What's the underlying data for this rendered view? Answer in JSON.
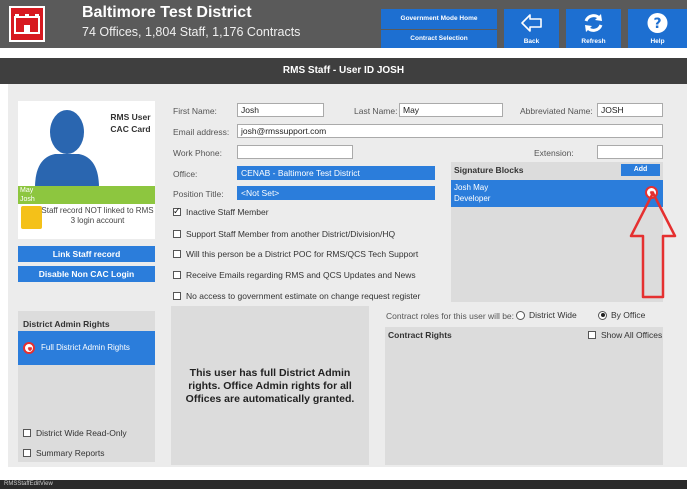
{
  "header": {
    "title": "Baltimore Test District",
    "subtitle": "74 Offices, 1,804 Staff, 1,176 Contracts",
    "gov_mode": "Government Mode Home",
    "contract_selection": "Contract Selection",
    "back": "Back",
    "refresh": "Refresh",
    "help": "Help"
  },
  "page_title": "RMS Staff - User ID JOSH",
  "avatar_card": {
    "title": "RMS User CAC Card",
    "name_line1": "May",
    "name_line2": "Josh",
    "status": "Staff record NOT linked to RMS 3 login account"
  },
  "buttons": {
    "link_staff": "Link Staff record",
    "disable_cac": "Disable Non CAC Login"
  },
  "form": {
    "first_name_label": "First Name:",
    "first_name": "Josh",
    "last_name_label": "Last Name:",
    "last_name": "May",
    "abbr_label": "Abbreviated Name:",
    "abbr": "JOSH",
    "email_label": "Email address:",
    "email": "josh@rmssupport.com",
    "work_phone_label": "Work Phone:",
    "work_phone": "",
    "extension_label": "Extension:",
    "extension": "",
    "office_label": "Office:",
    "office": "CENAB - Baltimore Test District",
    "position_label": "Position Title:",
    "position": "<Not Set>"
  },
  "checkboxes": [
    {
      "label": "Inactive Staff Member",
      "checked": true
    },
    {
      "label": "Support Staff Member from another District/Division/HQ",
      "checked": false
    },
    {
      "label": "Will this person be a District POC for RMS/QCS Tech Support",
      "checked": false
    },
    {
      "label": "Receive Emails regarding RMS and QCS Updates and News",
      "checked": false
    },
    {
      "label": "No access to government estimate on change request register",
      "checked": false
    }
  ],
  "signature": {
    "title": "Signature Blocks",
    "add": "Add",
    "item_name": "Josh May",
    "item_role": "Developer"
  },
  "district": {
    "title": "District Admin Rights",
    "full_rights": "Full District Admin Rights",
    "readonly": "District Wide Read-Only",
    "summary": "Summary Reports"
  },
  "message": "This user has full District Admin rights. Office Admin rights for all Offices are automatically granted.",
  "contract": {
    "roles_label": "Contract roles for this user will be:",
    "district_wide": "District Wide",
    "by_office": "By Office",
    "rights_title": "Contract Rights",
    "show_all": "Show All Offices"
  },
  "statusbar": "RMSStaffEditView",
  "colors": {
    "accent": "#2b7ddb",
    "header": "#5a5a5a",
    "annotation": "#e53030"
  }
}
